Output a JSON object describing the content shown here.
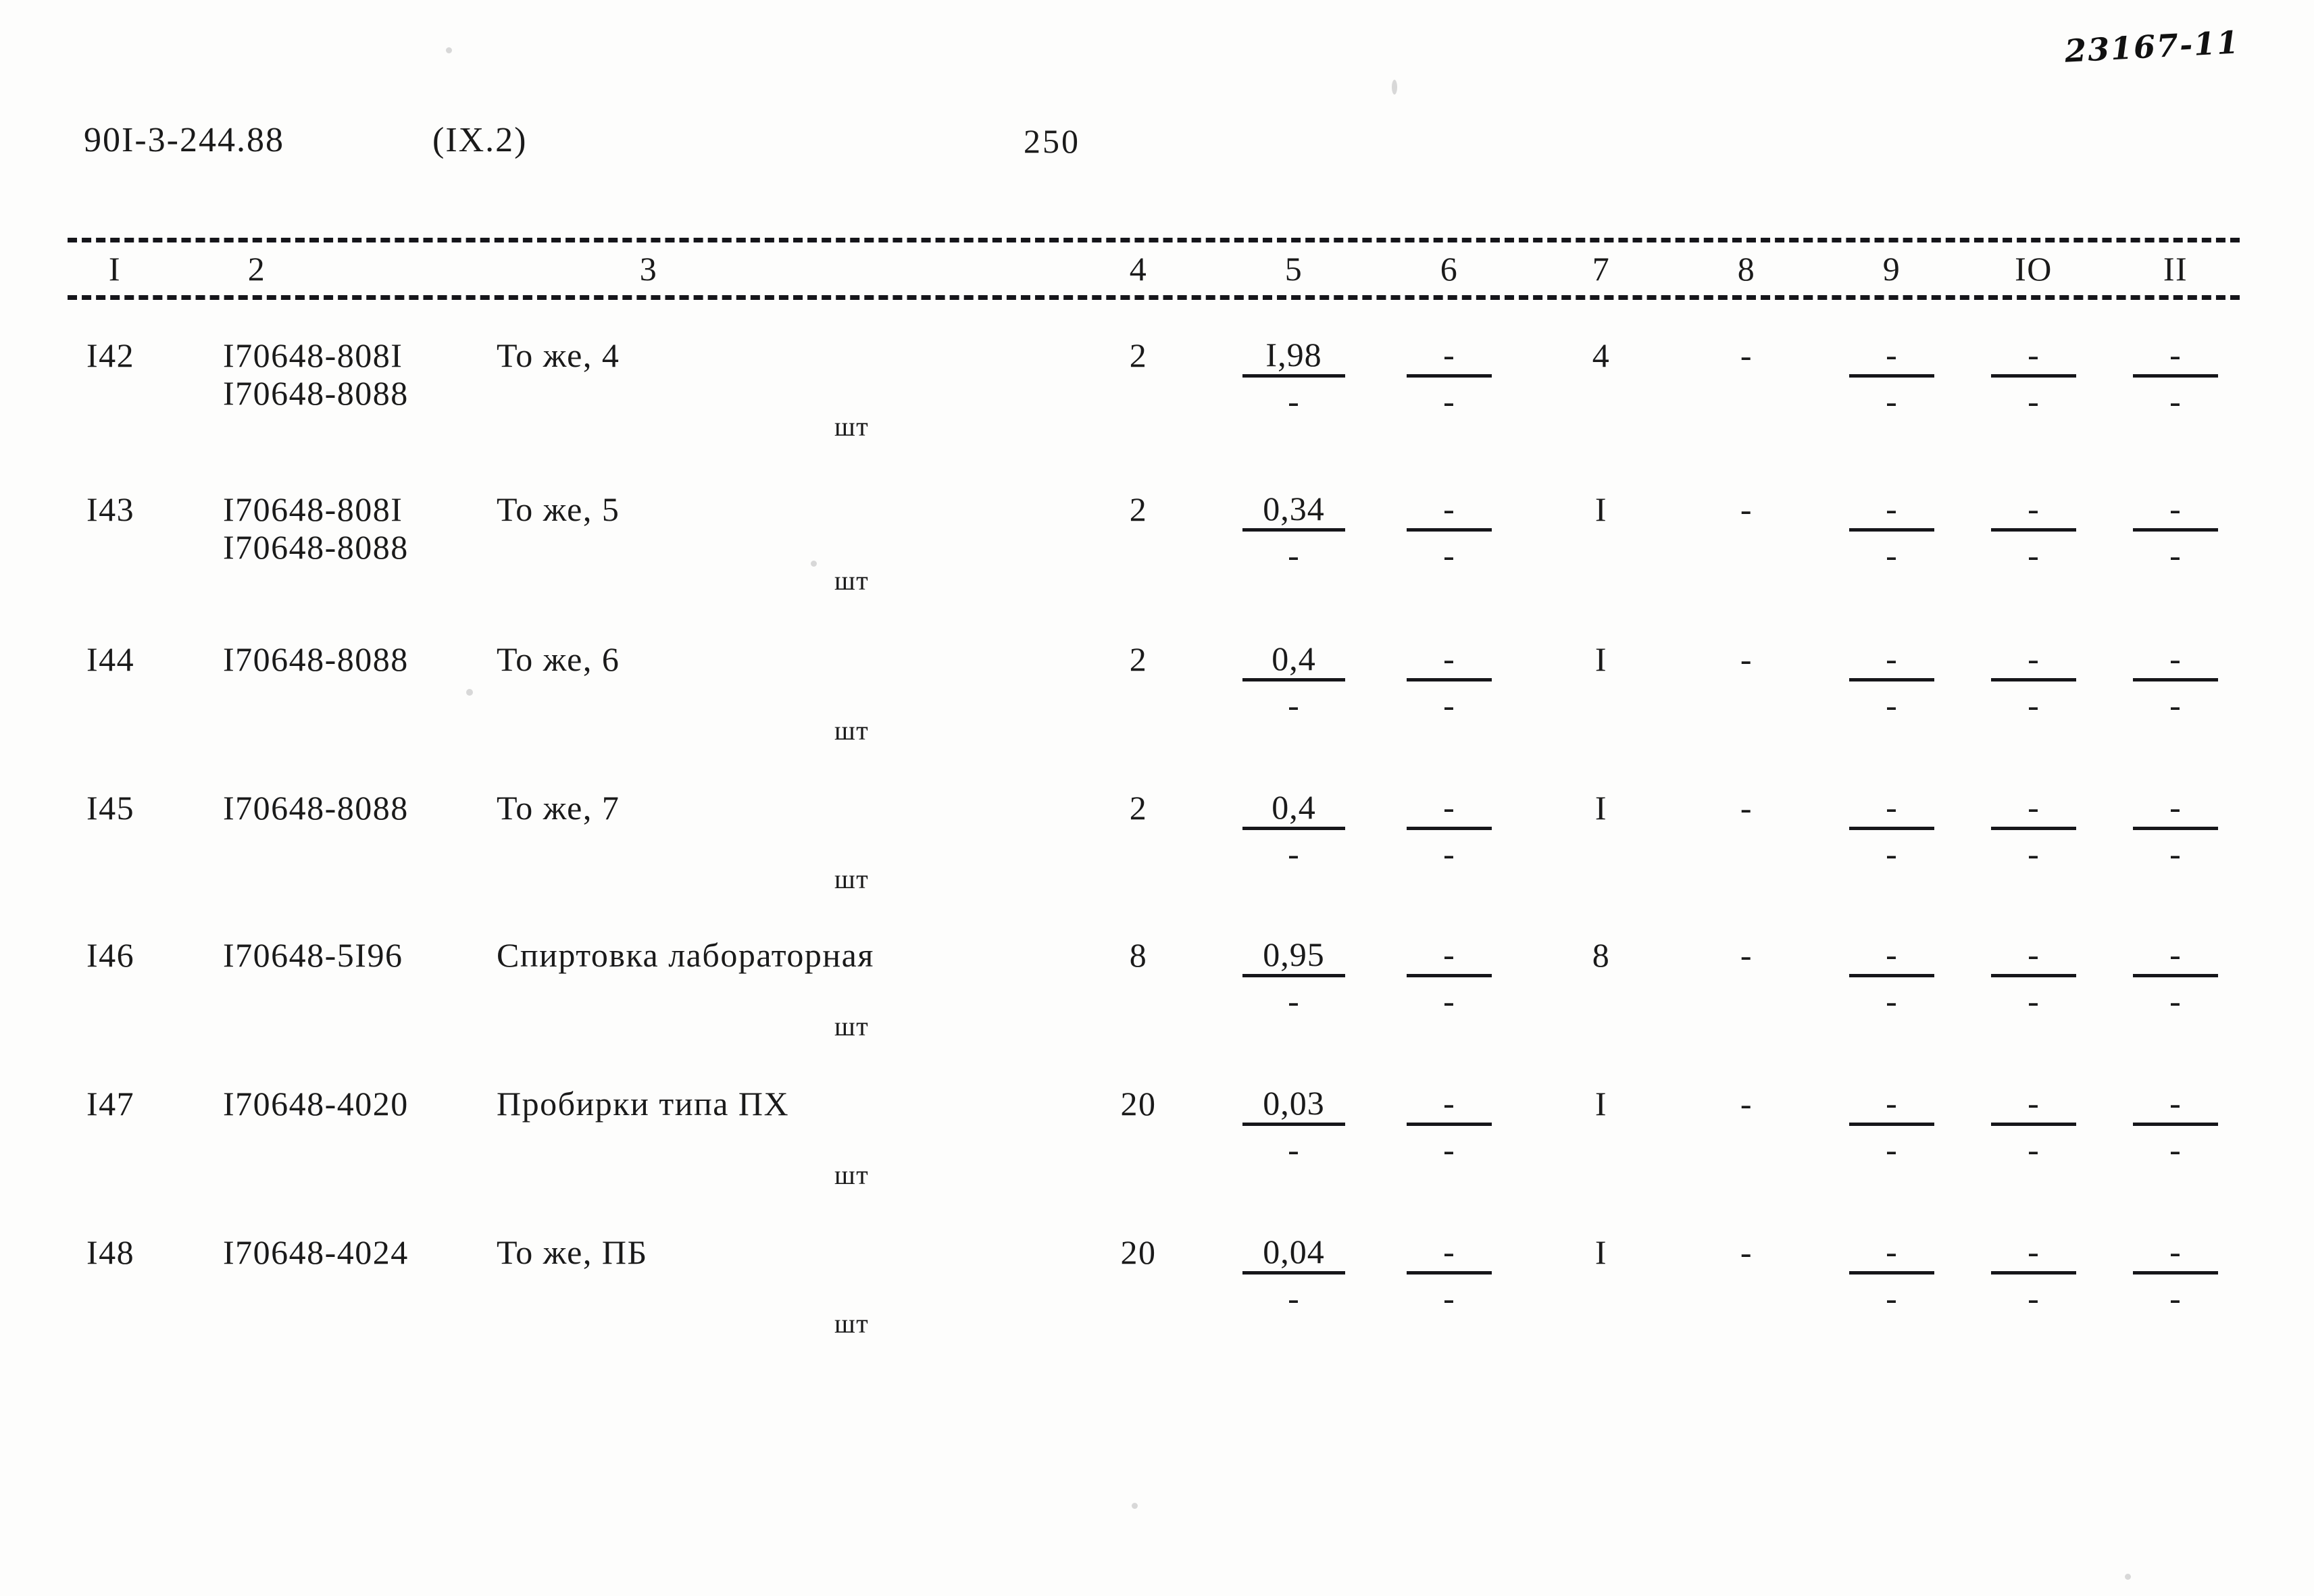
{
  "annotations": {
    "handwritten_archive_code": "23167-11"
  },
  "header": {
    "document_code": "90I-3-244.88",
    "section": "(IX.2)",
    "page_number": "250"
  },
  "table": {
    "column_headers": [
      "I",
      "2",
      "3",
      "4",
      "5",
      "6",
      "7",
      "8",
      "9",
      "IO",
      "II"
    ],
    "unit_label": "шт",
    "rows": [
      {
        "num": "I42",
        "code1": "I70648-808I",
        "code2": "I70648-8088",
        "name": "То же, 4",
        "unit": "шт",
        "c4": "2",
        "c5_num": "I,98",
        "c5_den": "-",
        "c6_num": "-",
        "c6_den": "-",
        "c7": "4",
        "c8": "-",
        "c9_num": "-",
        "c9_den": "-",
        "c10_num": "-",
        "c10_den": "-",
        "c11_num": "-",
        "c11_den": "-"
      },
      {
        "num": "I43",
        "code1": "I70648-808I",
        "code2": "I70648-8088",
        "name": "То же, 5",
        "unit": "шт",
        "c4": "2",
        "c5_num": "0,34",
        "c5_den": "-",
        "c6_num": "-",
        "c6_den": "-",
        "c7": "I",
        "c8": "-",
        "c9_num": "-",
        "c9_den": "-",
        "c10_num": "-",
        "c10_den": "-",
        "c11_num": "-",
        "c11_den": "-"
      },
      {
        "num": "I44",
        "code1": "I70648-8088",
        "code2": "",
        "name": "То же, 6",
        "unit": "шт",
        "c4": "2",
        "c5_num": "0,4",
        "c5_den": "-",
        "c6_num": "-",
        "c6_den": "-",
        "c7": "I",
        "c8": "-",
        "c9_num": "-",
        "c9_den": "-",
        "c10_num": "-",
        "c10_den": "-",
        "c11_num": "-",
        "c11_den": "-"
      },
      {
        "num": "I45",
        "code1": "I70648-8088",
        "code2": "",
        "name": "То же, 7",
        "unit": "шт",
        "c4": "2",
        "c5_num": "0,4",
        "c5_den": "-",
        "c6_num": "-",
        "c6_den": "-",
        "c7": "I",
        "c8": "-",
        "c9_num": "-",
        "c9_den": "-",
        "c10_num": "-",
        "c10_den": "-",
        "c11_num": "-",
        "c11_den": "-"
      },
      {
        "num": "I46",
        "code1": "I70648-5I96",
        "code2": "",
        "name": "Спиртовка лабораторная",
        "unit": "шт",
        "c4": "8",
        "c5_num": "0,95",
        "c5_den": "-",
        "c6_num": "-",
        "c6_den": "-",
        "c7": "8",
        "c8": "-",
        "c9_num": "-",
        "c9_den": "-",
        "c10_num": "-",
        "c10_den": "-",
        "c11_num": "-",
        "c11_den": "-"
      },
      {
        "num": "I47",
        "code1": "I70648-4020",
        "code2": "",
        "name": "Пробирки типа ПХ",
        "unit": "шт",
        "c4": "20",
        "c5_num": "0,03",
        "c5_den": "-",
        "c6_num": "-",
        "c6_den": "-",
        "c7": "I",
        "c8": "-",
        "c9_num": "-",
        "c9_den": "-",
        "c10_num": "-",
        "c10_den": "-",
        "c11_num": "-",
        "c11_den": "-"
      },
      {
        "num": "I48",
        "code1": "I70648-4024",
        "code2": "",
        "name": "То же, ПБ",
        "unit": "шт",
        "c4": "20",
        "c5_num": "0,04",
        "c5_den": "-",
        "c6_num": "-",
        "c6_den": "-",
        "c7": "I",
        "c8": "-",
        "c9_num": "-",
        "c9_den": "-",
        "c10_num": "-",
        "c10_den": "-",
        "c11_num": "-",
        "c11_den": "-"
      }
    ]
  }
}
